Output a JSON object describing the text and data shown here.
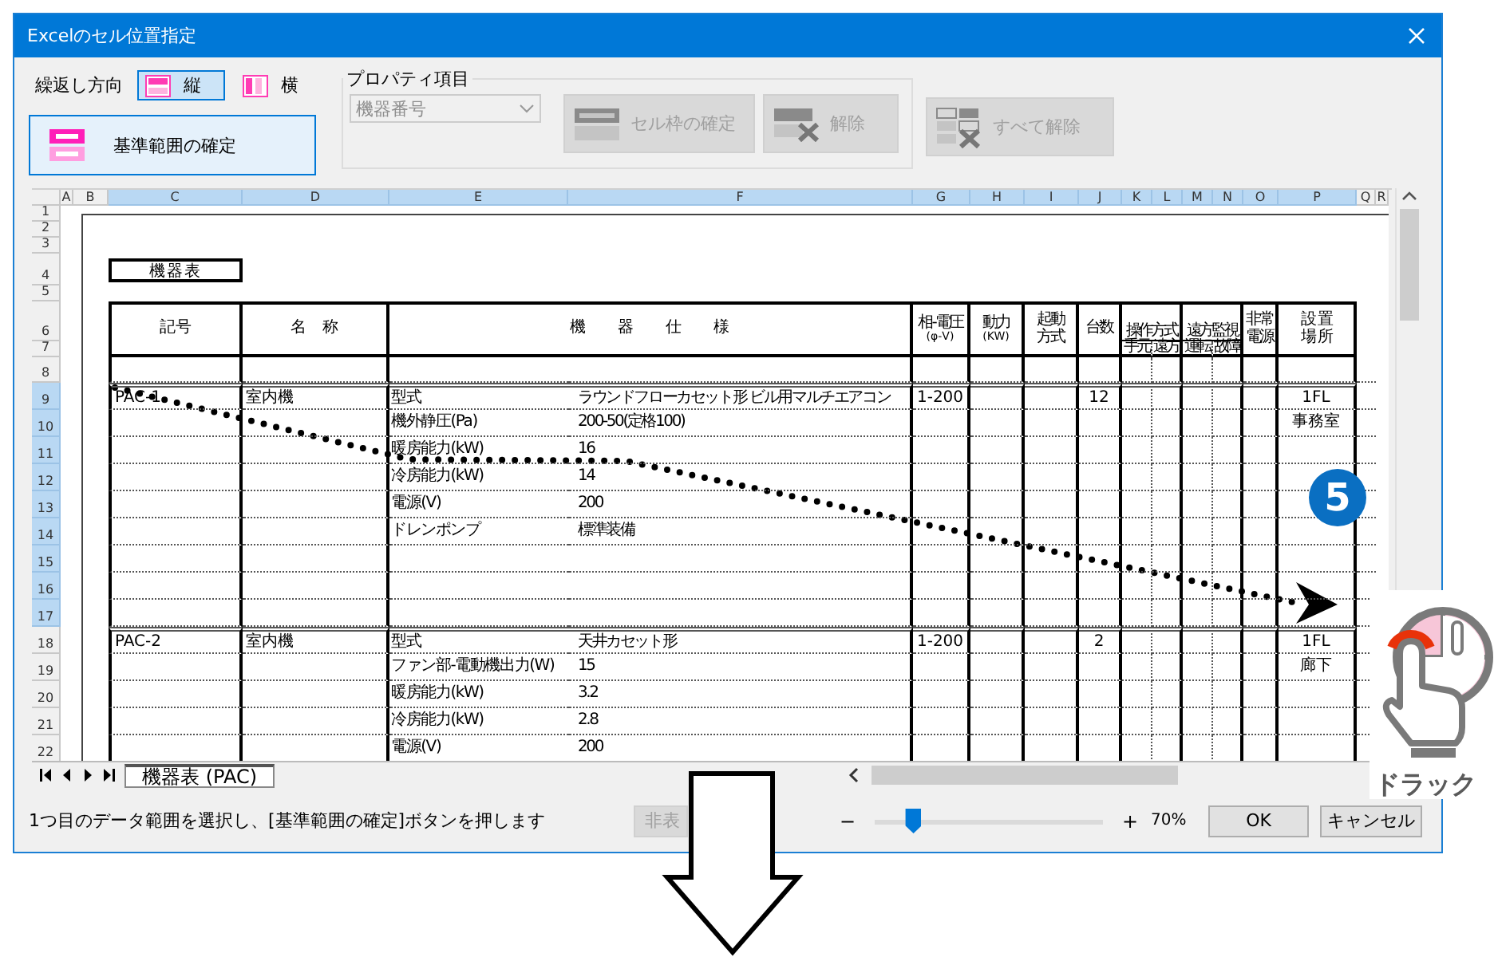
{
  "window": {
    "title": "Excelのセル位置指定"
  },
  "toolbar": {
    "repeat_label": "繰返し方向",
    "directions": [
      {
        "label": "縦",
        "selected": true
      },
      {
        "label": "横",
        "selected": false
      }
    ],
    "base_range_button": {
      "label": "基準範囲の確定"
    },
    "property_group": {
      "title": "プロパティ項目",
      "dropdown": {
        "value": "機器番号",
        "disabled": true
      }
    },
    "buttons": [
      {
        "kind": "cell",
        "label": "セル枠の確定",
        "disabled": true
      },
      {
        "kind": "clear",
        "label": "解除",
        "disabled": true
      },
      {
        "kind": "clear_all",
        "label": "すべて解除",
        "disabled": true
      }
    ]
  },
  "sheet": {
    "columns": [
      {
        "label": "A",
        "selected": false
      },
      {
        "label": "B",
        "selected": false
      },
      {
        "label": "C",
        "selected": true
      },
      {
        "label": "D",
        "selected": true
      },
      {
        "label": "E",
        "selected": true
      },
      {
        "label": "F",
        "selected": true
      },
      {
        "label": "G",
        "selected": true
      },
      {
        "label": "H",
        "selected": true
      },
      {
        "label": "I",
        "selected": true
      },
      {
        "label": "J",
        "selected": true
      },
      {
        "label": "K",
        "selected": true
      },
      {
        "label": "L",
        "selected": true
      },
      {
        "label": "M",
        "selected": true
      },
      {
        "label": "N",
        "selected": true
      },
      {
        "label": "O",
        "selected": true
      },
      {
        "label": "P",
        "selected": true
      },
      {
        "label": "Q",
        "selected": false
      },
      {
        "label": "R",
        "selected": false
      }
    ],
    "rows": [
      {
        "label": "1",
        "selected": false
      },
      {
        "label": "2",
        "selected": false
      },
      {
        "label": "3",
        "selected": false
      },
      {
        "label": "4",
        "selected": false
      },
      {
        "label": "5",
        "selected": false
      },
      {
        "label": "6",
        "selected": false
      },
      {
        "label": "7",
        "selected": false
      },
      {
        "label": "8",
        "selected": false
      },
      {
        "label": "9",
        "selected": true
      },
      {
        "label": "10",
        "selected": true
      },
      {
        "label": "11",
        "selected": true
      },
      {
        "label": "12",
        "selected": true
      },
      {
        "label": "13",
        "selected": true
      },
      {
        "label": "14",
        "selected": true
      },
      {
        "label": "15",
        "selected": true
      },
      {
        "label": "16",
        "selected": true
      },
      {
        "label": "17",
        "selected": true
      },
      {
        "label": "18",
        "selected": false
      },
      {
        "label": "19",
        "selected": false
      },
      {
        "label": "20",
        "selected": false
      },
      {
        "label": "21",
        "selected": false
      },
      {
        "label": "22",
        "selected": false
      }
    ],
    "table_title": "機器表",
    "headers": {
      "symbol": "記号",
      "name": "名　称",
      "spec": "機　　器　　仕　　様",
      "phase_voltage": [
        "相-電圧",
        "(φ-V)"
      ],
      "power": [
        "動力",
        "(KW)"
      ],
      "start_method": [
        "起動",
        "方式"
      ],
      "count": [
        "台数"
      ],
      "operation": {
        "title": "操作方式",
        "sub": [
          "手元",
          "遠方"
        ]
      },
      "monitoring": {
        "title": "遠方監視",
        "sub": [
          "運転",
          "故障"
        ]
      },
      "emergency_power": [
        "非常",
        "電源"
      ],
      "location": [
        "設 置",
        "場 所"
      ]
    },
    "units": [
      {
        "code": "PAC-1",
        "name": "室内機",
        "phase_voltage": "1-200",
        "count": "12",
        "location": [
          "1FL",
          "事務室"
        ],
        "specs": [
          {
            "item": "型式",
            "value": "ラウンドフローカセット形 ビル用マルチエアコン"
          },
          {
            "item": "機外静圧(Pa)",
            "value": "200-50(定格100)"
          },
          {
            "item": "暖房能力(kW)",
            "value": "16"
          },
          {
            "item": "冷房能力(kW)",
            "value": "14"
          },
          {
            "item": "電源(V)",
            "value": "200"
          },
          {
            "item": "ドレンポンプ",
            "value": "標準装備"
          }
        ]
      },
      {
        "code": "PAC-2",
        "name": "室内機",
        "phase_voltage": "1-200",
        "count": "2",
        "location": [
          "1FL",
          "廊下"
        ],
        "specs": [
          {
            "item": "型式",
            "value": "天井カセット形"
          },
          {
            "item": "ファン部-電動機出力(W)",
            "value": "15"
          },
          {
            "item": "暖房能力(kW)",
            "value": "3.2"
          },
          {
            "item": "冷房能力(kW)",
            "value": "2.8"
          },
          {
            "item": "電源(V)",
            "value": "200"
          }
        ]
      }
    ],
    "sheet_tab": "機器表 (PAC)"
  },
  "status_bar": {
    "message": "1つ目のデータ範囲を選択し、[基準範囲の確定]ボタンを押します",
    "hide_button": {
      "label": "非表",
      "disabled": true
    },
    "zoom": {
      "minus": "−",
      "plus": "+",
      "level": 0.17,
      "reading": "70%"
    },
    "ok": "OK",
    "cancel": "キャンセル"
  },
  "overlay": {
    "step": "5",
    "drag_label": "ドラック"
  }
}
